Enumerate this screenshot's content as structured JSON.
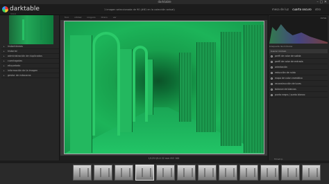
{
  "window": {
    "title": "darktable"
  },
  "header": {
    "brand": "darktable",
    "version": "3.6.0",
    "status": "1 imagen seleccionada de 90 (#61 en la colección actual)",
    "views": [
      {
        "label": "mesa de luz",
        "active": false
      },
      {
        "label": "cuarto oscuro",
        "active": true
      },
      {
        "label": "otro",
        "active": false
      }
    ]
  },
  "left_panel": {
    "items": [
      "instantáneas",
      "historial",
      "administración de duplicados",
      "cuentagotas",
      "etiquetado",
      "información de la imagen",
      "gestor de máscaras"
    ]
  },
  "center_toolbar": {
    "items": [
      "foco",
      "nitidez",
      "ninguno",
      "tónico",
      "ver"
    ]
  },
  "info_bar": "1/125 f/4.0 22 mm ISO 100",
  "right_panel": {
    "histogram_label": "curva",
    "tools": "búsqueda de módulos",
    "search_placeholder": "buscar módulo",
    "modules": [
      "perfil de color de salida",
      "perfil de color de entrada",
      "orientación",
      "reducción de ruido",
      "mapa de color cromático",
      "reconstrucción de luces",
      "balance de blancos",
      "punto negro / punto blanco"
    ]
  },
  "filmstrip": {
    "count": 12,
    "selected_index": 3,
    "footer": "filmstrip"
  },
  "colors": {
    "accent": "#22b65f",
    "panel_bg": "#262626",
    "background": "#1e1e1e"
  }
}
